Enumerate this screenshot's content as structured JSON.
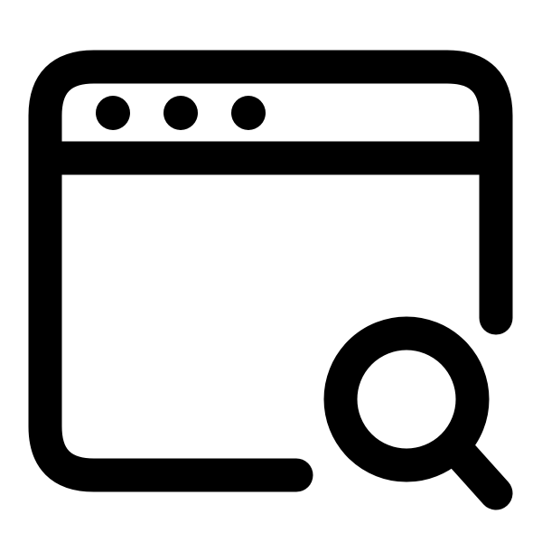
{
  "icon": {
    "name": "browser-window-search-icon",
    "stroke_color": "#000000",
    "background_color": "#ffffff",
    "window_dots_count": 3
  }
}
